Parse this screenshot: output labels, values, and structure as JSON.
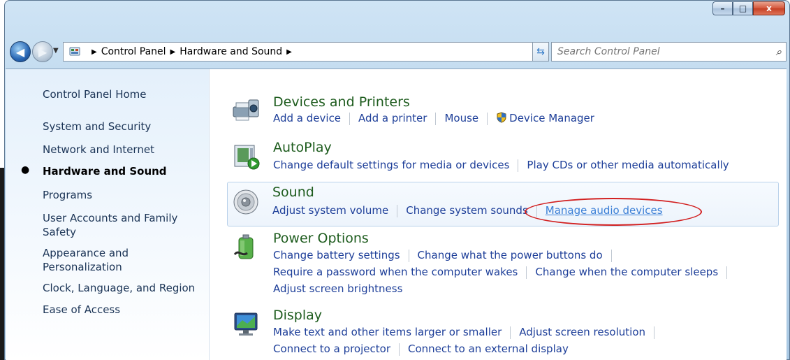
{
  "window": {
    "controls": {
      "minimize": "–",
      "maximize": "□",
      "close": "x"
    }
  },
  "address": {
    "crumbs": [
      "Control Panel",
      "Hardware and Sound"
    ],
    "search_placeholder": "Search Control Panel"
  },
  "sidebar": {
    "items": [
      {
        "label": "Control Panel Home",
        "active": false
      },
      {
        "label": "System and Security",
        "active": false
      },
      {
        "label": "Network and Internet",
        "active": false
      },
      {
        "label": "Hardware and Sound",
        "active": true
      },
      {
        "label": "Programs",
        "active": false
      },
      {
        "label": "User Accounts and Family Safety",
        "active": false
      },
      {
        "label": "Appearance and Personalization",
        "active": false
      },
      {
        "label": "Clock, Language, and Region",
        "active": false
      },
      {
        "label": "Ease of Access",
        "active": false
      }
    ]
  },
  "categories": {
    "devices": {
      "title": "Devices and Printers",
      "links": [
        "Add a device",
        "Add a printer",
        "Mouse",
        "Device Manager"
      ]
    },
    "autoplay": {
      "title": "AutoPlay",
      "links": [
        "Change default settings for media or devices",
        "Play CDs or other media automatically"
      ]
    },
    "sound": {
      "title": "Sound",
      "links": [
        "Adjust system volume",
        "Change system sounds",
        "Manage audio devices"
      ]
    },
    "power": {
      "title": "Power Options",
      "links": [
        "Change battery settings",
        "Change what the power buttons do",
        "Require a password when the computer wakes",
        "Change when the computer sleeps",
        "Adjust screen brightness"
      ]
    },
    "display": {
      "title": "Display",
      "links": [
        "Make text and other items larger or smaller",
        "Adjust screen resolution",
        "Connect to a projector",
        "Connect to an external display"
      ]
    }
  },
  "colors": {
    "category_title": "#1e5c1e",
    "link": "#1e3f99",
    "hover_link": "#3b7fd6",
    "annotation": "#d21f1f"
  }
}
